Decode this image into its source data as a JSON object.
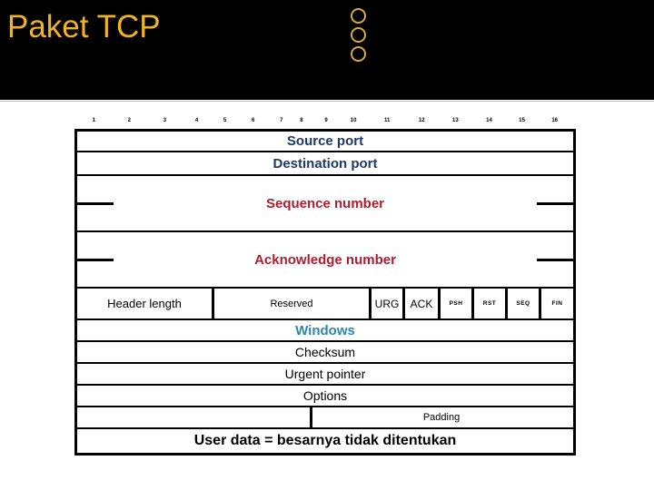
{
  "slide": {
    "title": "Paket TCP",
    "title_color": "#f0b323",
    "header_bg": "#000000",
    "decoration": {
      "icon": "three-circles-icon",
      "count": 3,
      "color": "#d8a843"
    }
  },
  "ruler": {
    "ticks": [
      "1",
      "2",
      "3",
      "4",
      "5",
      "6",
      "7",
      "8",
      "9",
      "10",
      "11",
      "12",
      "13",
      "14",
      "15",
      "16"
    ]
  },
  "colors": {
    "navy": "#1f3864",
    "red": "#b01b2e",
    "teal": "#2e86ab",
    "black": "#000000"
  },
  "packet": {
    "rows": [
      {
        "name": "source-port",
        "label": "Source port",
        "style": "navy"
      },
      {
        "name": "destination-port",
        "label": "Destination port",
        "style": "navy"
      },
      {
        "name": "sequence-number",
        "label": "Sequence number",
        "style": "red"
      },
      {
        "name": "acknowledge-number",
        "label": "Acknowledge number",
        "style": "red"
      },
      {
        "name": "windows",
        "label": "Windows",
        "style": "teal"
      },
      {
        "name": "checksum",
        "label": "Checksum",
        "style": "black"
      },
      {
        "name": "urgent-pointer",
        "label": "Urgent pointer",
        "style": "black"
      },
      {
        "name": "options",
        "label": "Options",
        "style": "black"
      },
      {
        "name": "padding",
        "label": "Padding",
        "style": "small"
      },
      {
        "name": "user-data",
        "label": "User data = besarnya tidak ditentukan",
        "style": "black-bold"
      }
    ],
    "flags_row": {
      "header_length": "Header length",
      "reserved": "Reserved",
      "flags": [
        "URG",
        "ACK",
        "PSH",
        "RST",
        "SEQ",
        "FIN"
      ]
    }
  }
}
